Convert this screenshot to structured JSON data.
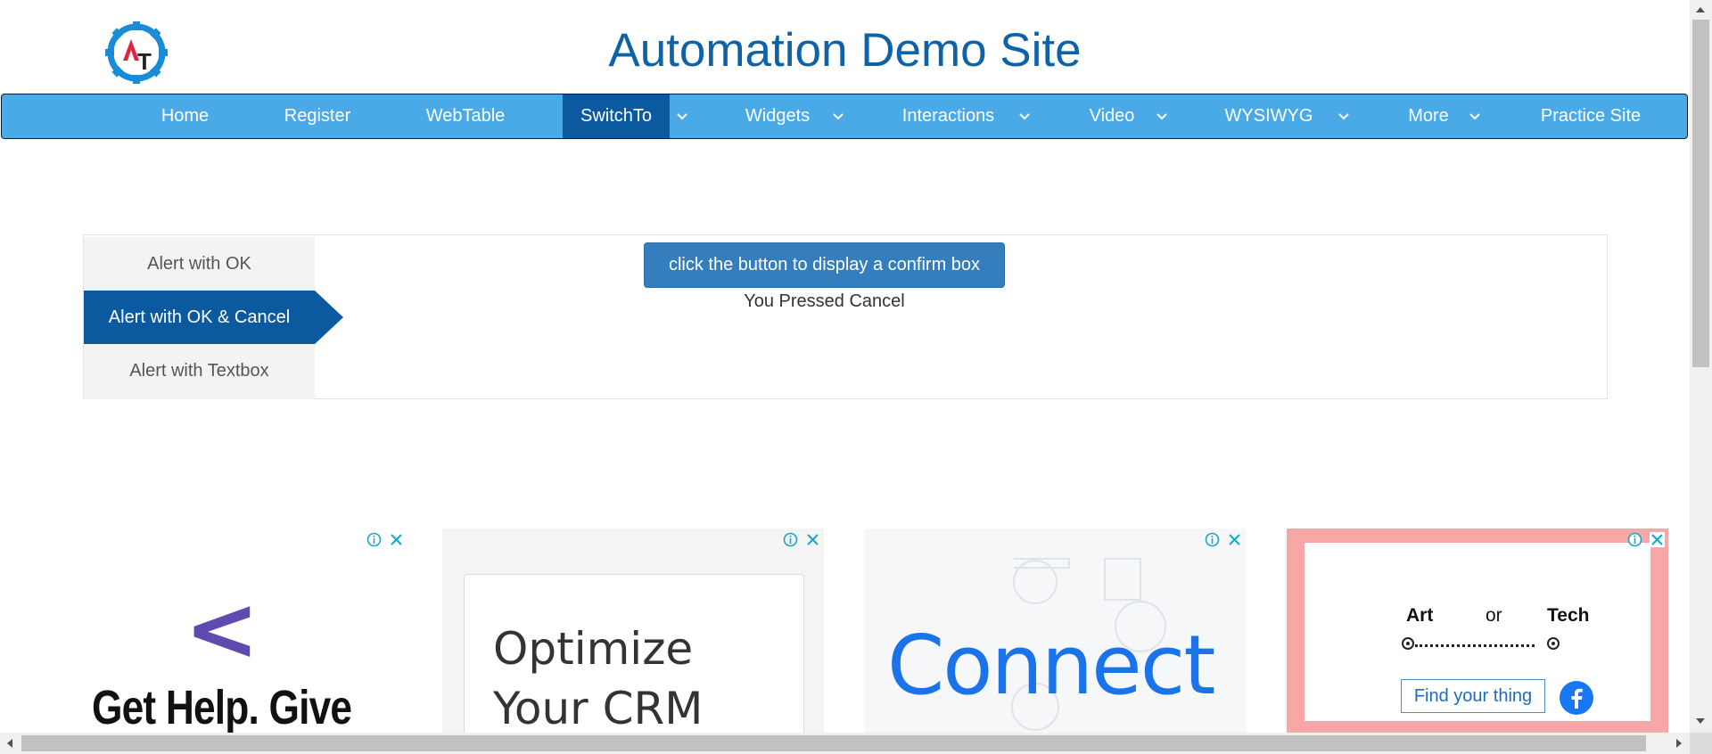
{
  "header": {
    "title": "Automation Demo Site",
    "logo_letters": [
      "A",
      "T"
    ]
  },
  "nav": {
    "items": [
      {
        "label": "Home"
      },
      {
        "label": "Register"
      },
      {
        "label": "WebTable"
      },
      {
        "label": "SwitchTo",
        "active": true
      },
      {
        "label": "Widgets"
      },
      {
        "label": "Interactions"
      },
      {
        "label": "Video"
      },
      {
        "label": "WYSIWYG"
      },
      {
        "label": "More"
      },
      {
        "label": "Practice Site"
      }
    ]
  },
  "alerts": {
    "tabs": [
      {
        "label": "Alert with OK"
      },
      {
        "label": "Alert with OK & Cancel",
        "active": true
      },
      {
        "label": "Alert with Textbox"
      }
    ],
    "button_label": "click the button to display a confirm box",
    "result_text": "You Pressed Cancel"
  },
  "ads": {
    "ad1": {
      "headline": "Get Help. Give"
    },
    "ad2": {
      "line1": "Optimize",
      "line2": "Your CRM"
    },
    "ad3": {
      "word": "Connect"
    },
    "ad4": {
      "option_left": "Art",
      "separator": "or",
      "option_right": "Tech",
      "cta": "Find your thing"
    }
  },
  "colors": {
    "nav_bg": "#4aaae8",
    "nav_active": "#0b5aa0",
    "title": "#0e62a8",
    "button": "#357ebd"
  }
}
